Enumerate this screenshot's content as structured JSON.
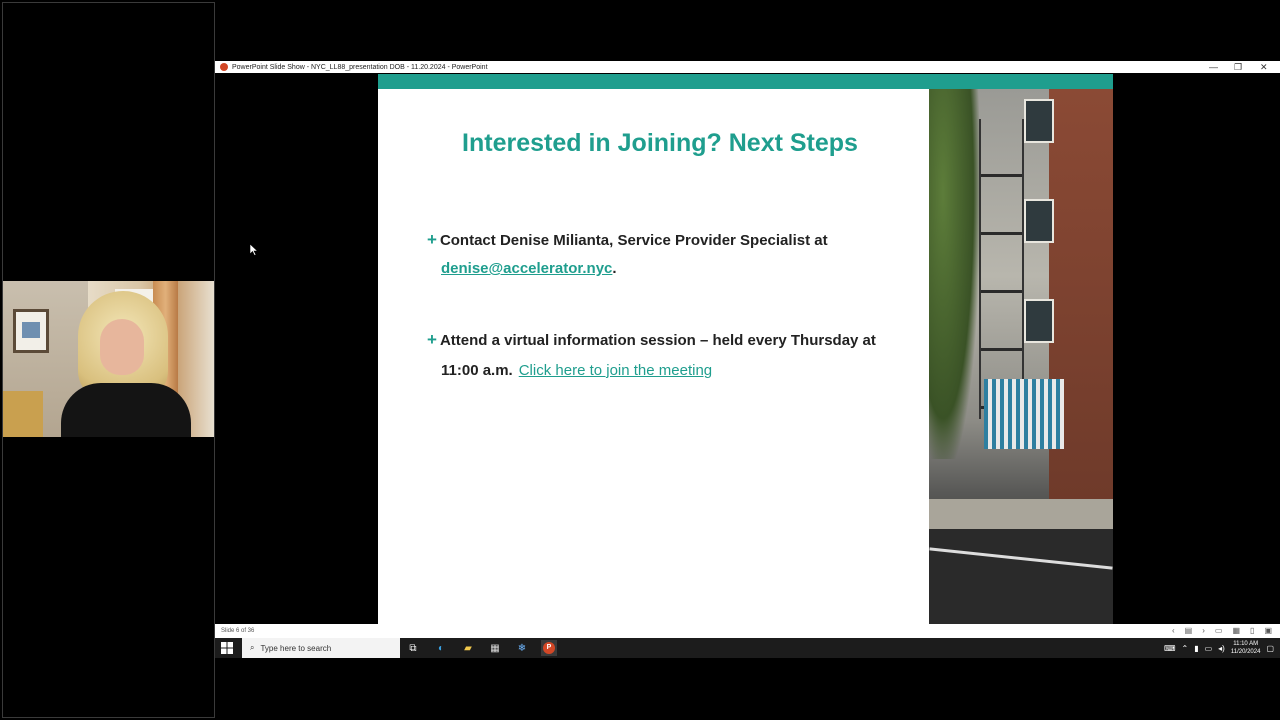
{
  "window": {
    "title": "PowerPoint Slide Show  -  NYC_LL88_presentation DOB - 11.20.2024 - PowerPoint",
    "minimize": "—",
    "restore": "❐",
    "close": "✕"
  },
  "slide": {
    "title": "Interested in Joining? Next Steps",
    "bullet1": {
      "text_line1": "Contact Denise Milianta, Service Provider Specialist at",
      "email": "denise@accelerator.nyc",
      "email_suffix": "."
    },
    "bullet2": {
      "text_line1": "Attend a virtual information session – held every Thursday at",
      "text_line2": "11:00 a.m.",
      "link": "Click here to join the meeting"
    },
    "accent_color": "#1f9e8e"
  },
  "statusbar": {
    "slide_counter": "Slide 6 of 36"
  },
  "taskbar": {
    "search_placeholder": "Type here to search",
    "clock_time": "11:10 AM",
    "clock_date": "11/20/2024"
  },
  "icons": {
    "plus": "+",
    "prev": "‹",
    "next": "›",
    "menu": "▤",
    "search": "⌕",
    "task_view": "⧉",
    "edge": "◐",
    "folder": "▰",
    "store": "▦",
    "snowflake": "❄",
    "powerpoint": "P",
    "chevron_up": "⌃",
    "mic": "▮",
    "network": "▭",
    "speaker": "◂)",
    "notification": "▢",
    "keyboard": "⌨",
    "normal_view": "▭",
    "slide_sorter": "▦",
    "reading_view": "▯",
    "slide_show": "▣"
  }
}
